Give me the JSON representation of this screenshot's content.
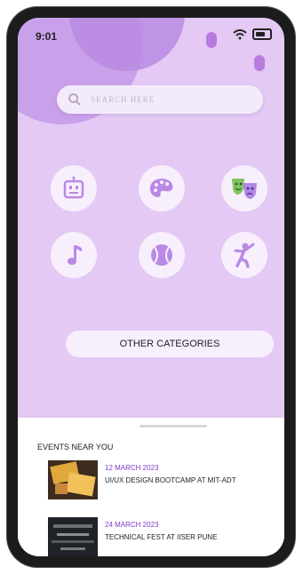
{
  "status": {
    "time": "9:01"
  },
  "search": {
    "placeholder": "SEARCH HERE"
  },
  "categories": [
    {
      "icon": "robot-icon"
    },
    {
      "icon": "palette-icon"
    },
    {
      "icon": "theater-masks-icon"
    },
    {
      "icon": "music-note-icon"
    },
    {
      "icon": "tennis-ball-icon"
    },
    {
      "icon": "dancer-icon"
    }
  ],
  "other_categories_label": "OTHER CATEGORIES",
  "events": {
    "title": "EVENTS NEAR YOU",
    "items": [
      {
        "date": "12 MARCH 2023",
        "title": "UI/UX DESIGN BOOTCAMP AT MIT-ADT"
      },
      {
        "date": "24 MARCH 2023",
        "title": "TECHNICAL FEST AT IISER PUNE"
      }
    ]
  },
  "colors": {
    "accent": "#b77ce0",
    "background": "#e3c9f4",
    "icon": "#b989e6",
    "date": "#7a3cc7"
  }
}
